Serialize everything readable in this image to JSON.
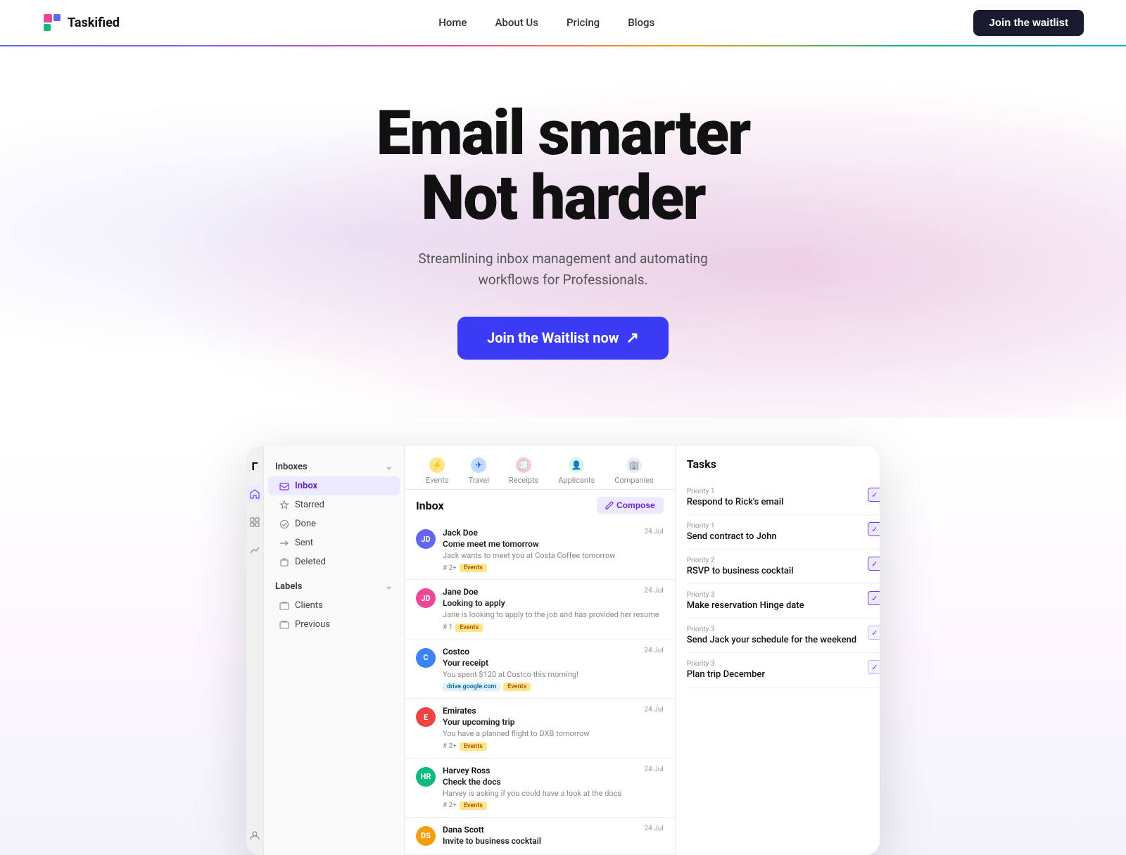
{
  "navbar": {
    "logo_text": "Taskified",
    "links": [
      {
        "label": "Home",
        "id": "home"
      },
      {
        "label": "About Us",
        "id": "about"
      },
      {
        "label": "Pricing",
        "id": "pricing"
      },
      {
        "label": "Blogs",
        "id": "blogs"
      }
    ],
    "cta_label": "Join the waitlist"
  },
  "hero": {
    "title_line1": "Email smarter",
    "title_line2": "Not harder",
    "subtitle": "Streamlining inbox management and automating\nworkflows for Professionals.",
    "cta_label": "Join the Waitlist now",
    "cta_arrow": "↗"
  },
  "app_preview": {
    "sidebar": {
      "logo": "Γ",
      "inboxes_label": "Inboxes",
      "items": [
        {
          "label": "Inbox",
          "icon": "inbox",
          "active": true
        },
        {
          "label": "Starred",
          "icon": "star"
        },
        {
          "label": "Done",
          "icon": "check"
        },
        {
          "label": "Sent",
          "icon": "send"
        },
        {
          "label": "Deleted",
          "icon": "trash"
        }
      ],
      "labels_label": "Labels",
      "label_items": [
        {
          "label": "Clients"
        },
        {
          "label": "Previous"
        }
      ]
    },
    "tabs": [
      {
        "label": "Events",
        "type": "events"
      },
      {
        "label": "Travel",
        "type": "travel"
      },
      {
        "label": "Receipts",
        "type": "receipts"
      },
      {
        "label": "Applicants",
        "type": "applicants"
      },
      {
        "label": "Companies",
        "type": "companies"
      }
    ],
    "inbox_title": "Inbox",
    "compose_label": "Compose",
    "emails": [
      {
        "sender": "Jack Doe",
        "subject": "Come meet me tomorrow",
        "preview": "Jack wants to meet you at Costa Coffee tomorrow",
        "date": "24 Jul",
        "avatar_color": "#6366f1",
        "avatar_initials": "JD",
        "tags": [
          "# 2+",
          "Events"
        ]
      },
      {
        "sender": "Jane Doe",
        "subject": "Looking to apply",
        "preview": "Jane is looking to apply to the job and has provided her resume",
        "date": "24 Jul",
        "avatar_color": "#ec4899",
        "avatar_initials": "JD",
        "tags": [
          "# 1",
          "Events"
        ]
      },
      {
        "sender": "Costco",
        "subject": "Your receipt",
        "preview": "You spent $120 at Costco this morning!",
        "date": "24 Jul",
        "avatar_color": "#3b82f6",
        "avatar_initials": "C",
        "tags": [
          "drive.google.com",
          "Events"
        ]
      },
      {
        "sender": "Emirates",
        "subject": "Your upcoming trip",
        "preview": "You have a planned flight to DXB tomorrow",
        "date": "24 Jul",
        "avatar_color": "#ef4444",
        "avatar_initials": "E",
        "tags": [
          "# 2+",
          "Events"
        ]
      },
      {
        "sender": "Harvey Ross",
        "subject": "Check the docs",
        "preview": "Harvey is asking if you could have a look at the docs",
        "date": "24 Jul",
        "avatar_color": "#10b981",
        "avatar_initials": "HR",
        "tags": [
          "# 2+",
          "Events"
        ]
      },
      {
        "sender": "Dana Scott",
        "subject": "Invite to business cocktail",
        "preview": "",
        "date": "24 Jul",
        "avatar_color": "#f59e0b",
        "avatar_initials": "DS",
        "tags": []
      }
    ],
    "tasks_title": "Tasks",
    "tasks": [
      {
        "priority": "Priority 1",
        "name": "Respond to Rick's email",
        "checked": true,
        "check_style": "checked"
      },
      {
        "priority": "Priority 1",
        "name": "Send contract to John",
        "checked": true,
        "check_style": "checked"
      },
      {
        "priority": "Priority 2",
        "name": "RSVP to business cocktail",
        "checked": true,
        "check_style": "checked"
      },
      {
        "priority": "Priority 3",
        "name": "Make reservation Hinge date",
        "checked": true,
        "check_style": "checked"
      },
      {
        "priority": "Priority 3",
        "name": "Send Jack your schedule for the weekend",
        "checked": true,
        "check_style": "checked-light"
      },
      {
        "priority": "Priority 3",
        "name": "Plan trip December",
        "checked": true,
        "check_style": "checked-light"
      }
    ]
  }
}
